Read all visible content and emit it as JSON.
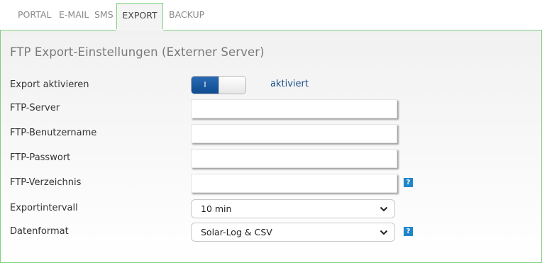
{
  "tabs": [
    {
      "label": "PORTAL"
    },
    {
      "label": "E-MAIL"
    },
    {
      "label": "SMS"
    },
    {
      "label": "EXPORT",
      "active": true
    },
    {
      "label": "BACKUP"
    }
  ],
  "panel": {
    "title": "FTP Export-Einstellungen (Externer Server)",
    "export": {
      "label": "Export aktivieren",
      "toggle_text": "I",
      "status": "aktiviert",
      "enabled": true
    },
    "ftp_server": {
      "label": "FTP-Server",
      "value": ""
    },
    "ftp_user": {
      "label": "FTP-Benutzername",
      "value": ""
    },
    "ftp_password": {
      "label": "FTP-Passwort",
      "value": ""
    },
    "ftp_dir": {
      "label": "FTP-Verzeichnis",
      "value": "",
      "help": "?"
    },
    "interval": {
      "label": "Exportintervall",
      "selected": "10 min"
    },
    "format": {
      "label": "Datenformat",
      "selected": "Solar-Log & CSV",
      "help": "?"
    }
  },
  "colors": {
    "accent_border": "#7ed07e",
    "toggle_on": "#0e4a8f",
    "status_text": "#1a4f8c",
    "help_bg": "#1f86c9"
  }
}
